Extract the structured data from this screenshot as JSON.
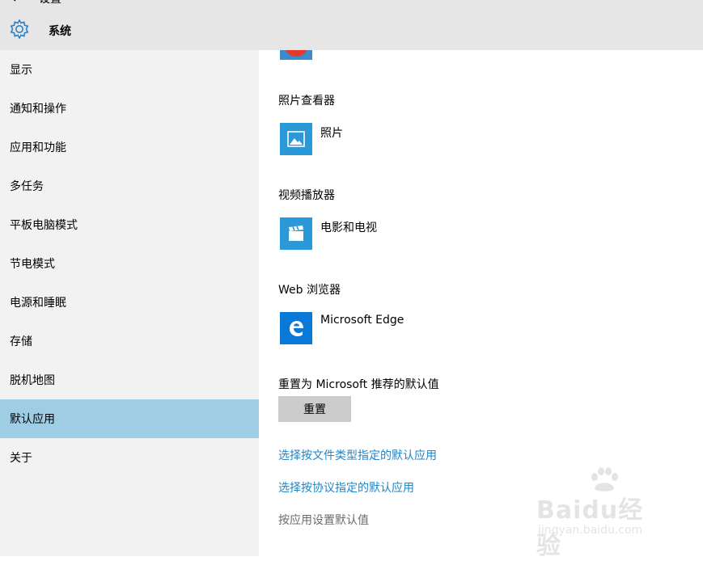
{
  "header": {
    "back_label": "设置",
    "section_title": "系统"
  },
  "sidebar": {
    "items": [
      {
        "label": "显示"
      },
      {
        "label": "通知和操作"
      },
      {
        "label": "应用和功能"
      },
      {
        "label": "多任务"
      },
      {
        "label": "平板电脑模式"
      },
      {
        "label": "节电模式"
      },
      {
        "label": "电源和睡眠"
      },
      {
        "label": "存储"
      },
      {
        "label": "脱机地图"
      },
      {
        "label": "默认应用",
        "active": true
      },
      {
        "label": "关于"
      }
    ]
  },
  "main": {
    "sections": [
      {
        "heading": "照片查看器",
        "app": "照片",
        "icon": "photo-icon"
      },
      {
        "heading": "视频播放器",
        "app": "电影和电视",
        "icon": "film-icon"
      },
      {
        "heading": "Web 浏览器",
        "app": "Microsoft Edge",
        "icon": "edge-icon"
      }
    ],
    "reset_heading": "重置为 Microsoft 推荐的默认值",
    "reset_button": "重置",
    "links": [
      "选择按文件类型指定的默认应用",
      "选择按协议指定的默认应用",
      "按应用设置默认值"
    ]
  },
  "watermark": {
    "brand": "Baidu经验",
    "url": "jingyan.baidu.com"
  },
  "colors": {
    "accent": "#1f86c8",
    "active_nav": "#9fcde3",
    "tile": "#2b98d8"
  }
}
